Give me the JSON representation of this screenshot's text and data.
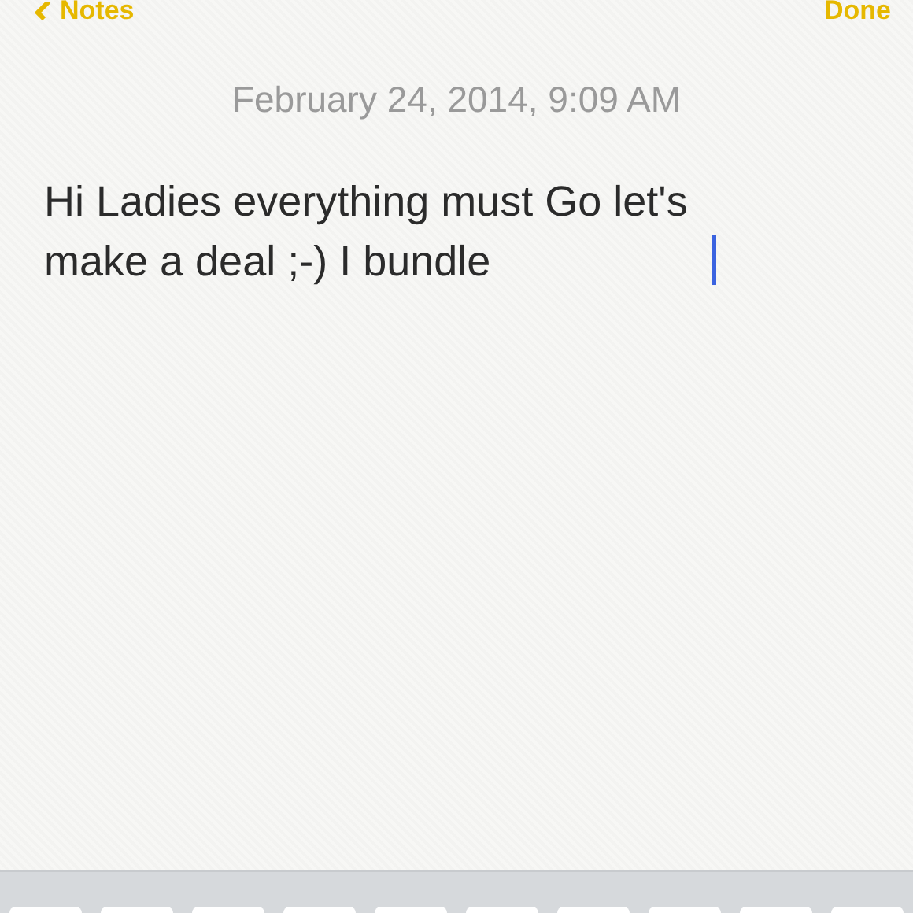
{
  "nav": {
    "back": "Notes",
    "done": "Done"
  },
  "note": {
    "date": "February 24, 2014, 9:09 AM",
    "body": "Hi Ladies everything must Go let's make a deal ;-) I bundle",
    "editing": true
  }
}
